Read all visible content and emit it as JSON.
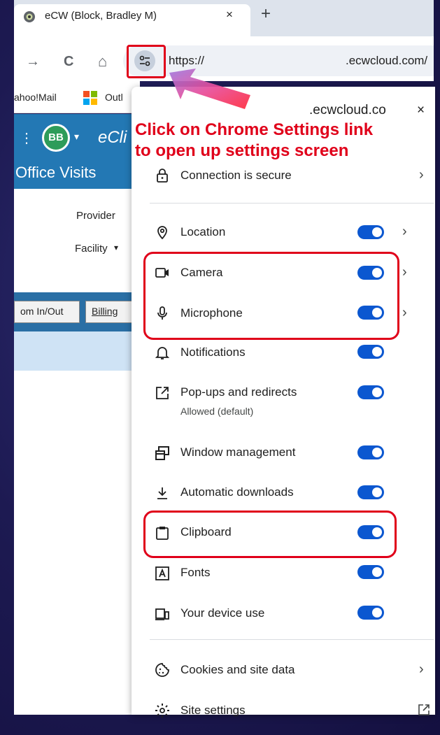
{
  "tab": {
    "title": "eCW (Block, Bradley M)",
    "close": "×",
    "new_tab": "+"
  },
  "toolbar": {
    "forward": "→",
    "reload": "C",
    "home": "⌂",
    "url_prefix": "https://",
    "url_domain": ".ecwcloud.com/"
  },
  "bookmarks": [
    {
      "label": "ahoo!Mail"
    },
    {
      "label": "Outl"
    }
  ],
  "ecw": {
    "avatar": "BB",
    "app_name": "eCli",
    "title": "Office Visits",
    "provider_label": "Provider",
    "facility_label": "Facility",
    "buttons": [
      "om In/Out",
      "Billing"
    ]
  },
  "popup": {
    "domain": ".ecwcloud.co",
    "close": "×",
    "connection": "Connection is secure",
    "rows": [
      {
        "label": "Location",
        "enabled": true,
        "chevron": true
      },
      {
        "label": "Camera",
        "enabled": true,
        "chevron": true
      },
      {
        "label": "Microphone",
        "enabled": true,
        "chevron": true
      },
      {
        "label": "Notifications",
        "enabled": true
      },
      {
        "label": "Pop-ups and redirects",
        "sublabel": "Allowed (default)",
        "enabled": true
      },
      {
        "label": "Window management",
        "enabled": true
      },
      {
        "label": "Automatic downloads",
        "enabled": true
      },
      {
        "label": "Clipboard",
        "enabled": true
      },
      {
        "label": "Fonts",
        "enabled": true
      },
      {
        "label": "Your device use",
        "enabled": true
      }
    ],
    "cookies": "Cookies and site data",
    "site_settings": "Site settings"
  },
  "annotation": {
    "line1": "Click on Chrome Settings link",
    "line2": "to open up settings screen"
  },
  "colors": {
    "accent": "#0b57d0",
    "annotation_red": "#e0001a",
    "ecw_blue": "#2378b4"
  }
}
